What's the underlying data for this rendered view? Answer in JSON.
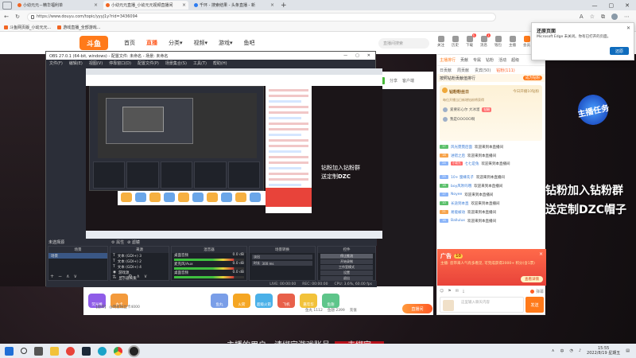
{
  "browser": {
    "tabs": [
      {
        "title": "小幼元元－精华福利单",
        "active": false
      },
      {
        "title": "小幼元元直播_小幼元元视频直播间",
        "active": true
      },
      {
        "title": "千环 - 搜索结果 - 头条直播 - 新",
        "active": false
      }
    ],
    "new_tab": "+",
    "url": "https://www.douyu.com/topic/yyyj1y?rid=3436094",
    "window_controls": [
      "—",
      "▢",
      "✕"
    ],
    "bookmarks": [
      "斗鱼网页版_小幼元元...",
      "游戏直播_全部游戏..."
    ]
  },
  "douyu": {
    "logo": "斗鱼",
    "nav": [
      "首页",
      "直播",
      "分类▾",
      "视频▾",
      "游戏▾",
      "鱼吧"
    ],
    "nav_active_index": 1,
    "search_placeholder": "直播间搜索",
    "header_icons": [
      {
        "label": "关注",
        "badge": ""
      },
      {
        "label": "历史",
        "badge": ""
      },
      {
        "label": "下载",
        "badge": "6"
      },
      {
        "label": "消息",
        "badge": "3"
      },
      {
        "label": "钱包",
        "badge": ""
      },
      {
        "label": "主播",
        "badge": ""
      },
      {
        "label": "会员",
        "badge": ""
      },
      {
        "label": "开播",
        "badge": ""
      }
    ]
  },
  "player": {
    "room_id": "3436094",
    "share": "分享",
    "client": "客户端",
    "overlay_line1": "钻粉加入钻粉群",
    "overlay_line2_prefix": "送定制",
    "overlay_line2_bold": "DZC",
    "overlay_line2_suffix": "帽子",
    "badge_text": "主播任务",
    "subtitle": "主播的用户，请绑定游戏账号",
    "subtitle_button": "去绑定"
  },
  "gifts": {
    "left": [
      "荧光棒",
      "办卡"
    ],
    "right": [
      "鱼丸",
      "火箭",
      "超级火箭",
      "飞机",
      "嘉年华",
      "鱼翅"
    ],
    "fans_card": "【虚荣】 @明星粉丝卡4000",
    "balance": "鱼丸 1112",
    "yuchi": "鱼翅 2399",
    "recharge": "充值",
    "go_button": "直播间"
  },
  "obs": {
    "title": "OBS 27.0.1 (64-bit, windows) - 配置文件: 未命名 - 场景: 未命名",
    "menu": [
      "文件(F)",
      "编辑(E)",
      "视图(V)",
      "停靠窗口(D)",
      "配置文件(P)",
      "场景集合(S)",
      "工具(T)",
      "帮助(H)"
    ],
    "no_source": "未选择源",
    "props": "⚙ 属性",
    "filters": "⊘ 滤镜",
    "docks": {
      "scenes": {
        "title": "场景",
        "items": [
          "场景"
        ]
      },
      "sources": {
        "title": "来源",
        "items": [
          "文本 (GDI+) 3",
          "文本 (GDI+) 2",
          "文本 (GDI+) 4",
          "游戏源",
          "显示器采集"
        ]
      },
      "mixer": {
        "title": "混音器",
        "channels": [
          {
            "name": "桌面音频",
            "level": "0.0 dB"
          },
          {
            "name": "麦克风/Aux",
            "level": "0.0 dB"
          },
          {
            "name": "桌面音频",
            "level": "0.0 dB"
          }
        ]
      },
      "transitions": {
        "title": "场景转换",
        "transition": "淡出",
        "duration_label": "时长",
        "duration": "300 ms"
      },
      "controls": {
        "title": "控件",
        "buttons": [
          "停止推流",
          "开始录制",
          "工作室模式",
          "设置",
          "退出"
        ]
      }
    },
    "status": [
      "LIVE: 00:00:00",
      "REC: 00:00:00",
      "CPU: 3.6%, 60.00 fps"
    ]
  },
  "chat": {
    "header": [
      "主播排行",
      "贡献",
      "专属",
      "钻粉",
      "活动"
    ],
    "header_right": "超级",
    "rank_tabs": [
      "日贡献",
      "周贡献",
      "贵宾(50)",
      "钻粉(111)"
    ],
    "rank_tabs_active": 3,
    "rank_line": "按照钻粉贡献值排行",
    "rank_button": "成为钻粉",
    "fans_title": "钻粉粉丝日",
    "fans_sub": "今日开播10钻粉",
    "fans_desc": "每位开播当日新增钻粉将获得",
    "fans_rows": [
      {
        "name": "爱要彩心尔  大冰溜",
        "tag": "钻粉"
      },
      {
        "name": "我是OOOOO啊",
        "tag": ""
      }
    ],
    "messages": [
      {
        "lv": "17",
        "color": "g",
        "name": "风光霓霓后面",
        "text": "欢迎来到本直播间"
      },
      {
        "lv": "18",
        "color": "o",
        "name": "进错之后",
        "text": "欢迎来到本直播间"
      },
      {
        "lv": "24",
        "color": "b",
        "name": "七七是兔",
        "text": "欢迎来到本直播间",
        "fan": "小幼元",
        "tall": true
      },
      {
        "lv": "25",
        "color": "b",
        "name": "10+ 蜜蜂先子",
        "text": "欢迎来到本直播间"
      },
      {
        "lv": "18",
        "color": "g",
        "name": "boy风吹吗哦",
        "text": "欢迎来到本直播间"
      },
      {
        "lv": "17",
        "color": "b",
        "name": "Noyee",
        "text": "欢迎来到本直播间"
      },
      {
        "lv": "10",
        "color": "g",
        "name": "长途到本直",
        "text": "欢迎来到本直播间"
      },
      {
        "lv": "21",
        "color": "o",
        "name": "易能被动",
        "text": "欢迎来到本直播间"
      },
      {
        "lv": "18",
        "color": "b",
        "name": "Ballulux",
        "text": "欢迎来到本直播间"
      }
    ],
    "ad_title": "广告",
    "ad_count": "10",
    "ad_text": "主播: 您带来人气有多看见, 可完成获得2000+ 积分(含1票)",
    "ad_button": "查看详情",
    "input_placeholder": "这里输入聊天内容",
    "send": "发送",
    "tools": [
      "☺",
      "⚑",
      "✉",
      "⤓"
    ],
    "bullet_toggle": "弹幕"
  },
  "popup": {
    "title": "还原页面",
    "desc": "Microsoft Edge 未关闭。你有已打开的页面。",
    "button": "还原"
  },
  "taskbar": {
    "apps": [
      "search",
      "task-view",
      "files",
      "huya",
      "steam",
      "edge",
      "chrome",
      "obs"
    ],
    "tray_lang": "中",
    "time": "15:55",
    "date": "2022/8/19 星期五"
  }
}
